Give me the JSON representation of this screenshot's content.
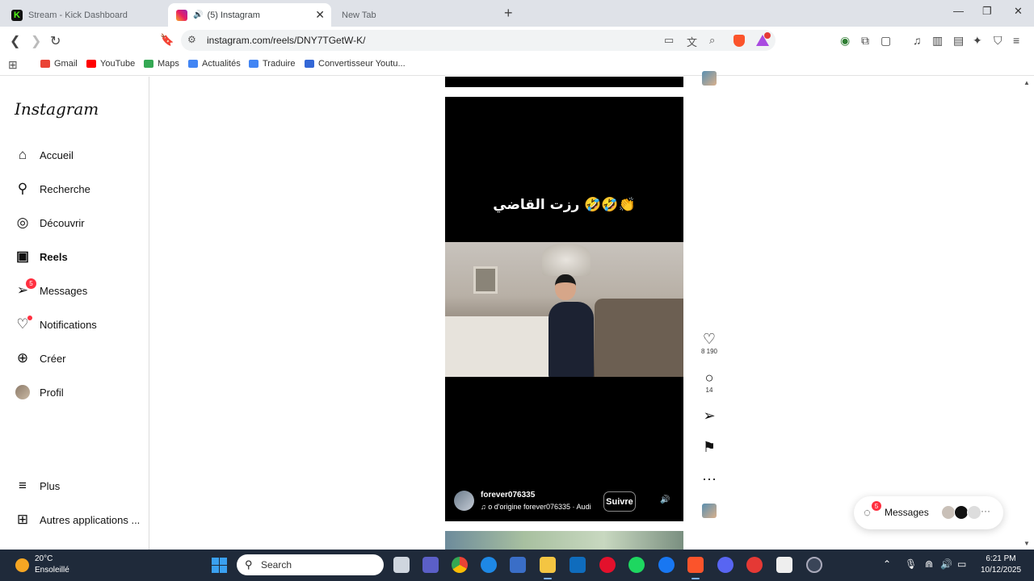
{
  "browser": {
    "tabs": [
      {
        "title": "Stream - Kick Dashboard"
      },
      {
        "title": "(5) Instagram"
      },
      {
        "title": "New Tab"
      }
    ],
    "url": "instagram.com/reels/DNY7TGetW-K/",
    "bookmarks": [
      {
        "label": "Gmail"
      },
      {
        "label": "YouTube"
      },
      {
        "label": "Maps"
      },
      {
        "label": "Actualités"
      },
      {
        "label": "Traduire"
      },
      {
        "label": "Convertisseur Youtu..."
      }
    ]
  },
  "instagram": {
    "logo": "Instagram",
    "nav": [
      {
        "label": "Accueil",
        "icon": "home-icon"
      },
      {
        "label": "Recherche",
        "icon": "search-icon"
      },
      {
        "label": "Découvrir",
        "icon": "compass-icon"
      },
      {
        "label": "Reels",
        "icon": "reels-icon"
      },
      {
        "label": "Messages",
        "icon": "messenger-icon",
        "badge": "5"
      },
      {
        "label": "Notifications",
        "icon": "heart-icon"
      },
      {
        "label": "Créer",
        "icon": "plus-square-icon"
      },
      {
        "label": "Profil",
        "icon": "avatar"
      }
    ],
    "more": {
      "label": "Plus"
    },
    "other_apps": {
      "label": "Autres applications ..."
    },
    "reel": {
      "caption": "رزت القاضي 🤣🤣👏",
      "username": "forever076335",
      "audio": "o d'origine    forever076335 · Audi",
      "follow_label": "Suivre"
    },
    "actions": {
      "likes": "8 190",
      "comments": "14"
    },
    "messages_pill": {
      "label": "Messages",
      "badge": "5"
    }
  },
  "taskbar": {
    "weather_temp": "20°C",
    "weather_desc": "Ensoleillé",
    "search_placeholder": "Search",
    "time": "6:21 PM",
    "date": "10/12/2025"
  }
}
